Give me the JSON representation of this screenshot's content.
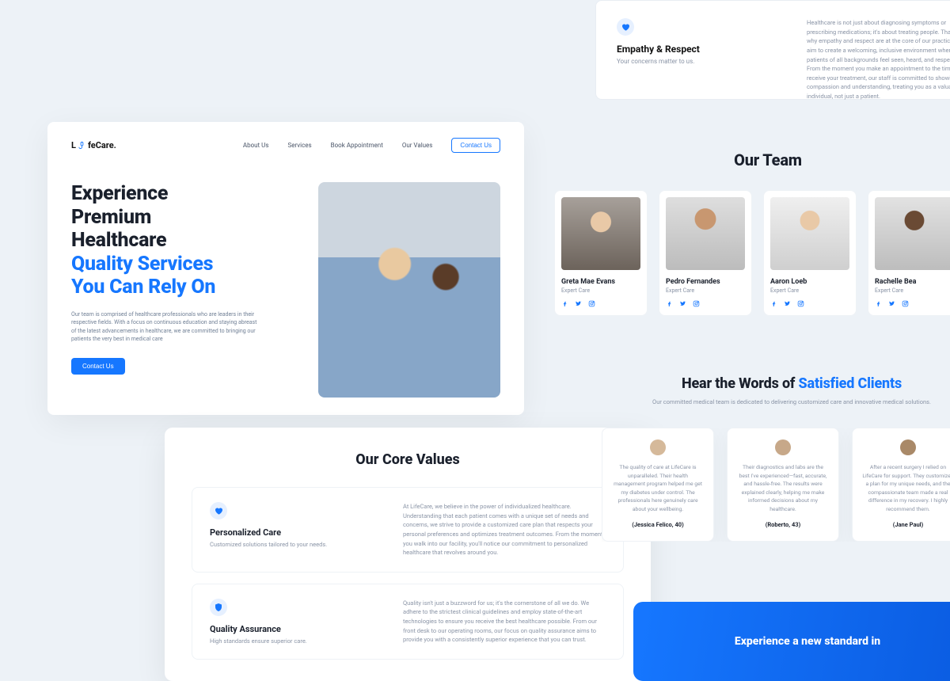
{
  "brand": {
    "prefix": "L",
    "suffix": "feCare."
  },
  "nav": {
    "about": "About Us",
    "services": "Services",
    "book": "Book Appointment",
    "values": "Our Values",
    "contact": "Contact Us"
  },
  "hero": {
    "title_l1": "Experience",
    "title_l2": "Premium",
    "title_l3": "Healthcare",
    "title_accent_l1": "Quality Services",
    "title_accent_l2": "You Can Rely On",
    "desc": "Our team is comprised of healthcare professionals who are leaders in their respective fields. With a focus on continuous education and staying abreast of the latest advancements in healthcare, we are committed to bringing our patients the very best in medical care",
    "cta": "Contact Us"
  },
  "value_top": {
    "title": "Empathy & Respect",
    "subtitle": "Your concerns matter to us.",
    "desc": "Healthcare is not just about diagnosing symptoms or prescribing medications; it's about treating people. That's why empathy and respect are at the core of our practice. We aim to create a welcoming, inclusive environment where patients of all backgrounds feel seen, heard, and respected. From the moment you make an appointment to the time you receive your treatment, our staff is committed to showing compassion and understanding, treating you as a valuable individual, not just a patient."
  },
  "team": {
    "heading": "Our Team",
    "role": "Expert Care",
    "members": [
      {
        "name": "Greta Mae Evans"
      },
      {
        "name": "Pedro Fernandes"
      },
      {
        "name": "Aaron Loeb"
      },
      {
        "name": "Rachelle Bea"
      }
    ]
  },
  "core_values": {
    "heading": "Our Core Values",
    "items": [
      {
        "title": "Personalized Care",
        "subtitle": "Customized solutions tailored to your needs.",
        "desc": "At LifeCare, we believe in the power of individualized healthcare. Understanding that each patient comes with a unique set of needs and concerns, we strive to provide a customized care plan that respects your personal preferences and optimizes treatment outcomes. From the moment you walk into our facility, you'll notice our commitment to personalized healthcare that revolves around you."
      },
      {
        "title": "Quality Assurance",
        "subtitle": "High standards ensure superior care.",
        "desc": "Quality isn't just a buzzword for us; it's the cornerstone of all we do. We adhere to the strictest clinical guidelines and employ state-of-the-art technologies to ensure you receive the best healthcare possible. From our front desk to our operating rooms, our focus on quality assurance aims to provide you with a consistently superior experience that you can trust."
      }
    ]
  },
  "testimonials": {
    "heading_pre": "Hear the Words of ",
    "heading_accent": "Satisfied Clients",
    "subtitle": "Our committed medical team is dedicated to delivering customized care and innovative medical solutions.",
    "items": [
      {
        "quote": "The quality of care at LifeCare is unparalleled. Their health management program helped me get my diabetes under control. The professionals here genuinely care about your wellbeing.",
        "author": "(Jessica Felico, 40)"
      },
      {
        "quote": "Their diagnostics and labs are the best I've experienced—fast, accurate, and hassle-free. The results were explained clearly, helping me make informed decisions about my healthcare.",
        "author": "(Roberto, 43)"
      },
      {
        "quote": "After a recent surgery I relied on LifeCare for support. They customized a plan for my unique needs, and the compassionate team made a real difference in my recovery. I highly recommend them.",
        "author": "(Jane Paul)"
      }
    ]
  },
  "cta": {
    "headline": "Experience a new standard in"
  }
}
